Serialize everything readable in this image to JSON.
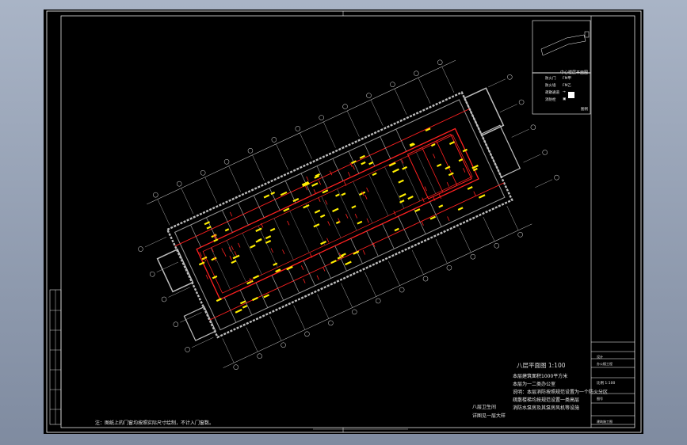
{
  "drawing": {
    "plan_title": "八层平面图 1:100",
    "bottom_note": "注：图纸上的门窗均按照实际尺寸绘制，不计入门窗数。",
    "stair_notes": [
      "八层卫生间",
      "详图见一层大样"
    ],
    "notes": [
      "本层建筑面积1000平方米",
      "本层为一二类办公室",
      "说明：本层消防按照规范设置为一个防火分区",
      "疏散楼梯均按规范设置一类高层",
      "消防水泵房及其泵房风机等设施"
    ]
  },
  "key_plan": {
    "title": "中心楼层平面图"
  },
  "legend": {
    "items": [
      {
        "label": "防火门",
        "value": "FM甲"
      },
      {
        "label": "防火墙",
        "value": "FM乙"
      },
      {
        "label": "疏散通道",
        "value": "→"
      },
      {
        "label": "消防栓",
        "value": "▣"
      }
    ],
    "extra": "图例"
  },
  "title_block": {
    "row1": "设计",
    "row2": "办公楼工程",
    "scale": "比例 1:100",
    "row4": "图号",
    "row5": "建筑施工图"
  },
  "colors": {
    "background": "#000000",
    "frame": "#ffffff",
    "grid": "#d8d8d8",
    "walls": "#c8c8c8",
    "corridor": "#ff2020",
    "labels": "#ffee00",
    "window_chrome": "#8f9bb0"
  }
}
